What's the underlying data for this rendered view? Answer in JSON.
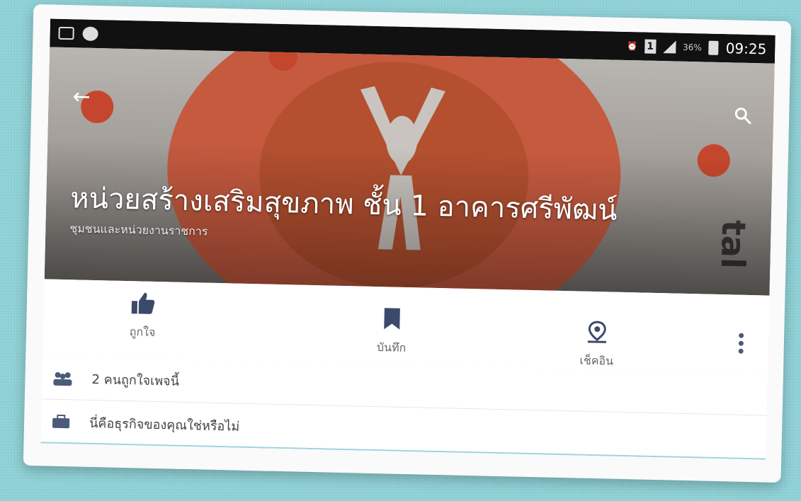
{
  "status_bar": {
    "time": "09:25",
    "battery_text": "36%",
    "sim_label": "1",
    "left_icons": [
      "image-icon",
      "chat-icon"
    ],
    "right_icons": [
      "alarm-icon",
      "sim-icon",
      "signal-icon",
      "battery-icon"
    ]
  },
  "header": {
    "back_icon": "back-arrow-icon",
    "search_icon": "search-icon",
    "title": "หน่วยสร้างเสริมสุขภาพ ชั้น 1 อาคารศรีพัฒน์",
    "category": "ชุมชนและหน่วยงานราชการ",
    "cover_side_text": "tal"
  },
  "actions": [
    {
      "label": "ถูกใจ",
      "icon": "like-icon"
    },
    {
      "label": "บันทึก",
      "icon": "bookmark-icon"
    },
    {
      "label": "เช็คอิน",
      "icon": "check-in-icon"
    }
  ],
  "more_icon": "more-vertical-icon",
  "info_rows": [
    {
      "icon": "people-icon",
      "text": "2 คนถูกใจเพจนี้"
    },
    {
      "icon": "briefcase-icon",
      "text": "นี่คือธุรกิจของคุณใช่หรือไม่"
    }
  ],
  "colors": {
    "background": "#8ccfd4",
    "logo_orange": "#c55a3f",
    "action_icon": "#3b4a6b",
    "row_divider": "#9fd3dc"
  }
}
